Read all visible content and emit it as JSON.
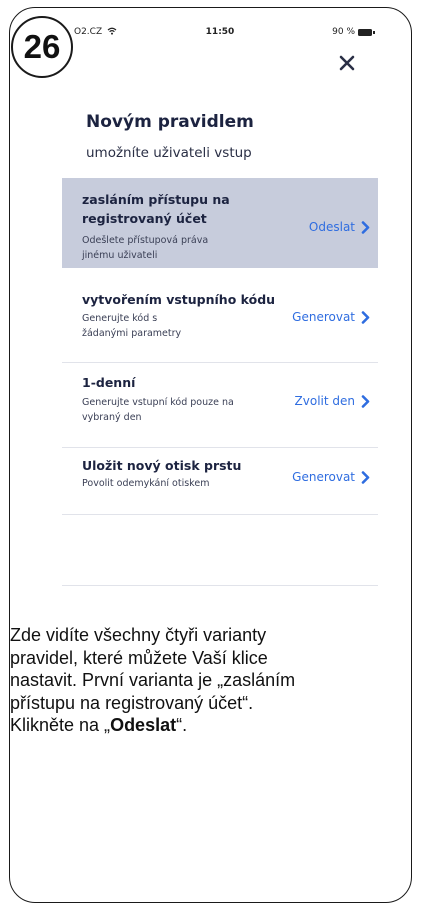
{
  "step_number": "26",
  "status_bar": {
    "carrier": "O2.CZ",
    "time": "11:50",
    "battery": "90 %"
  },
  "screen": {
    "title": "Novým pravidlem",
    "subtitle": "umožníte uživateli vstup",
    "options": [
      {
        "title_lines": [
          "zasláním přístupu na",
          "registrovaný účet"
        ],
        "description_lines": [
          "Odešlete přístupová práva",
          "jinému uživateli"
        ],
        "action": "Odeslat",
        "selected": true
      },
      {
        "title_lines": [
          "vytvořením vstupního kódu"
        ],
        "description_lines": [
          "Generujte kód s",
          "žádanými parametry"
        ],
        "action": "Generovat",
        "selected": false
      },
      {
        "title_lines": [
          "1-denní"
        ],
        "description_lines": [
          "Generujte vstupní kód pouze na",
          "vybraný den"
        ],
        "action": "Zvolit den",
        "selected": false
      },
      {
        "title_lines": [
          "Uložit nový otisk prstu"
        ],
        "description_lines": [
          "Povolit odemykání otiskem"
        ],
        "action": "Generovat",
        "selected": false
      }
    ]
  },
  "caption": {
    "line1": "Zde vidíte všechny čtyři varianty",
    "line2": "pravidel, které můžete Vaší klice",
    "line3": "nastavit. První varianta je „zasláním",
    "line4": "přístupu na registrovaný účet“.",
    "line5_prefix": "Klikněte na „",
    "line5_bold": "Odeslat",
    "line5_suffix": "“."
  },
  "colors": {
    "selected_row": "#c7ccdc",
    "action_blue": "#2f6de0",
    "title_navy": "#1c2340"
  }
}
